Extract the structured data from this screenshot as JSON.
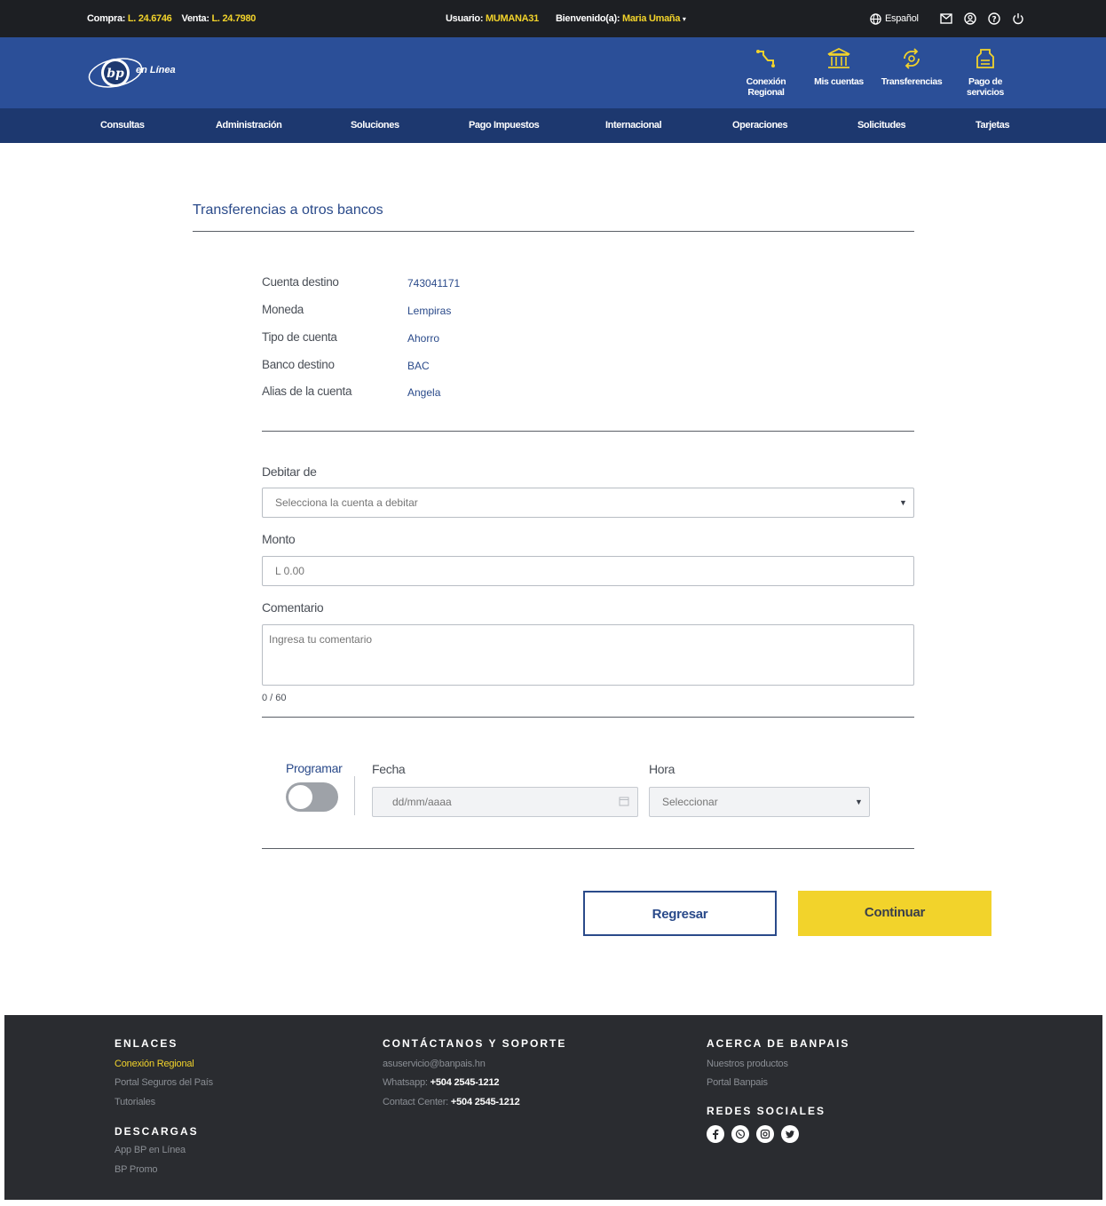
{
  "topbar": {
    "compra_label": "Compra:",
    "compra_value": "L. 24.6746",
    "venta_label": "Venta:",
    "venta_value": "L. 24.7980",
    "usuario_label": "Usuario:",
    "usuario_value": "MUMANA31",
    "bienvenido_label": "Bienvenido(a):",
    "bienvenido_value": "Maria Umaña",
    "language": "Español"
  },
  "header": {
    "logo_text": "en Línea",
    "quick_links": [
      {
        "label_1": "Conexión",
        "label_2": "Regional",
        "icon": "connection-icon"
      },
      {
        "label_1": "Mis cuentas",
        "label_2": "",
        "icon": "bank-icon"
      },
      {
        "label_1": "Transferencias",
        "label_2": "",
        "icon": "transfer-icon"
      },
      {
        "label_1": "Pago de",
        "label_2": "servicios",
        "icon": "bill-icon"
      }
    ]
  },
  "nav": [
    "Consultas",
    "Administración",
    "Soluciones",
    "Pago Impuestos",
    "Internacional",
    "Operaciones",
    "Solicitudes",
    "Tarjetas"
  ],
  "page": {
    "title": "Transferencias a otros bancos",
    "details": [
      {
        "label": "Cuenta destino",
        "value": "743041171"
      },
      {
        "label": "Moneda",
        "value": "Lempiras"
      },
      {
        "label": "Tipo de cuenta",
        "value": "Ahorro"
      },
      {
        "label": "Banco destino",
        "value": "BAC"
      },
      {
        "label": "Alias de la cuenta",
        "value": "Angela"
      }
    ],
    "debitar_label": "Debitar de",
    "debitar_placeholder": "Selecciona la cuenta a debitar",
    "monto_label": "Monto",
    "monto_placeholder": "L 0.00",
    "comentario_label": "Comentario",
    "comentario_placeholder": "Ingresa tu comentario",
    "counter": "0 / 60",
    "programar_label": "Programar",
    "fecha_label": "Fecha",
    "fecha_placeholder": "dd/mm/aaaa",
    "hora_label": "Hora",
    "hora_placeholder": "Seleccionar",
    "btn_back": "Regresar",
    "btn_next": "Continuar"
  },
  "footer": {
    "enlaces_title": "ENLACES",
    "enlaces": [
      "Conexión Regional",
      "Portal Seguros del País",
      "Tutoriales"
    ],
    "descargas_title": "DESCARGAS",
    "descargas": [
      "App BP en Línea",
      "BP Promo"
    ],
    "contacto_title": "CONTÁCTANOS Y SOPORTE",
    "email": "asuservicio@banpais.hn",
    "whatsapp_label": "Whatsapp:",
    "whatsapp_value": "+504 2545-1212",
    "contact_label": "Contact Center:",
    "contact_value": "+504 2545-1212",
    "acerca_title": "ACERCA DE BANPAIS",
    "acerca": [
      "Nuestros productos",
      "Portal Banpais"
    ],
    "redes_title": "REDES SOCIALES"
  },
  "colors": {
    "accent_yellow": "#f2d32b",
    "header_blue": "#2b4f98",
    "nav_blue": "#1d386f",
    "topbar_dark": "#1d1f23",
    "footer_dark": "#2a2c30"
  }
}
